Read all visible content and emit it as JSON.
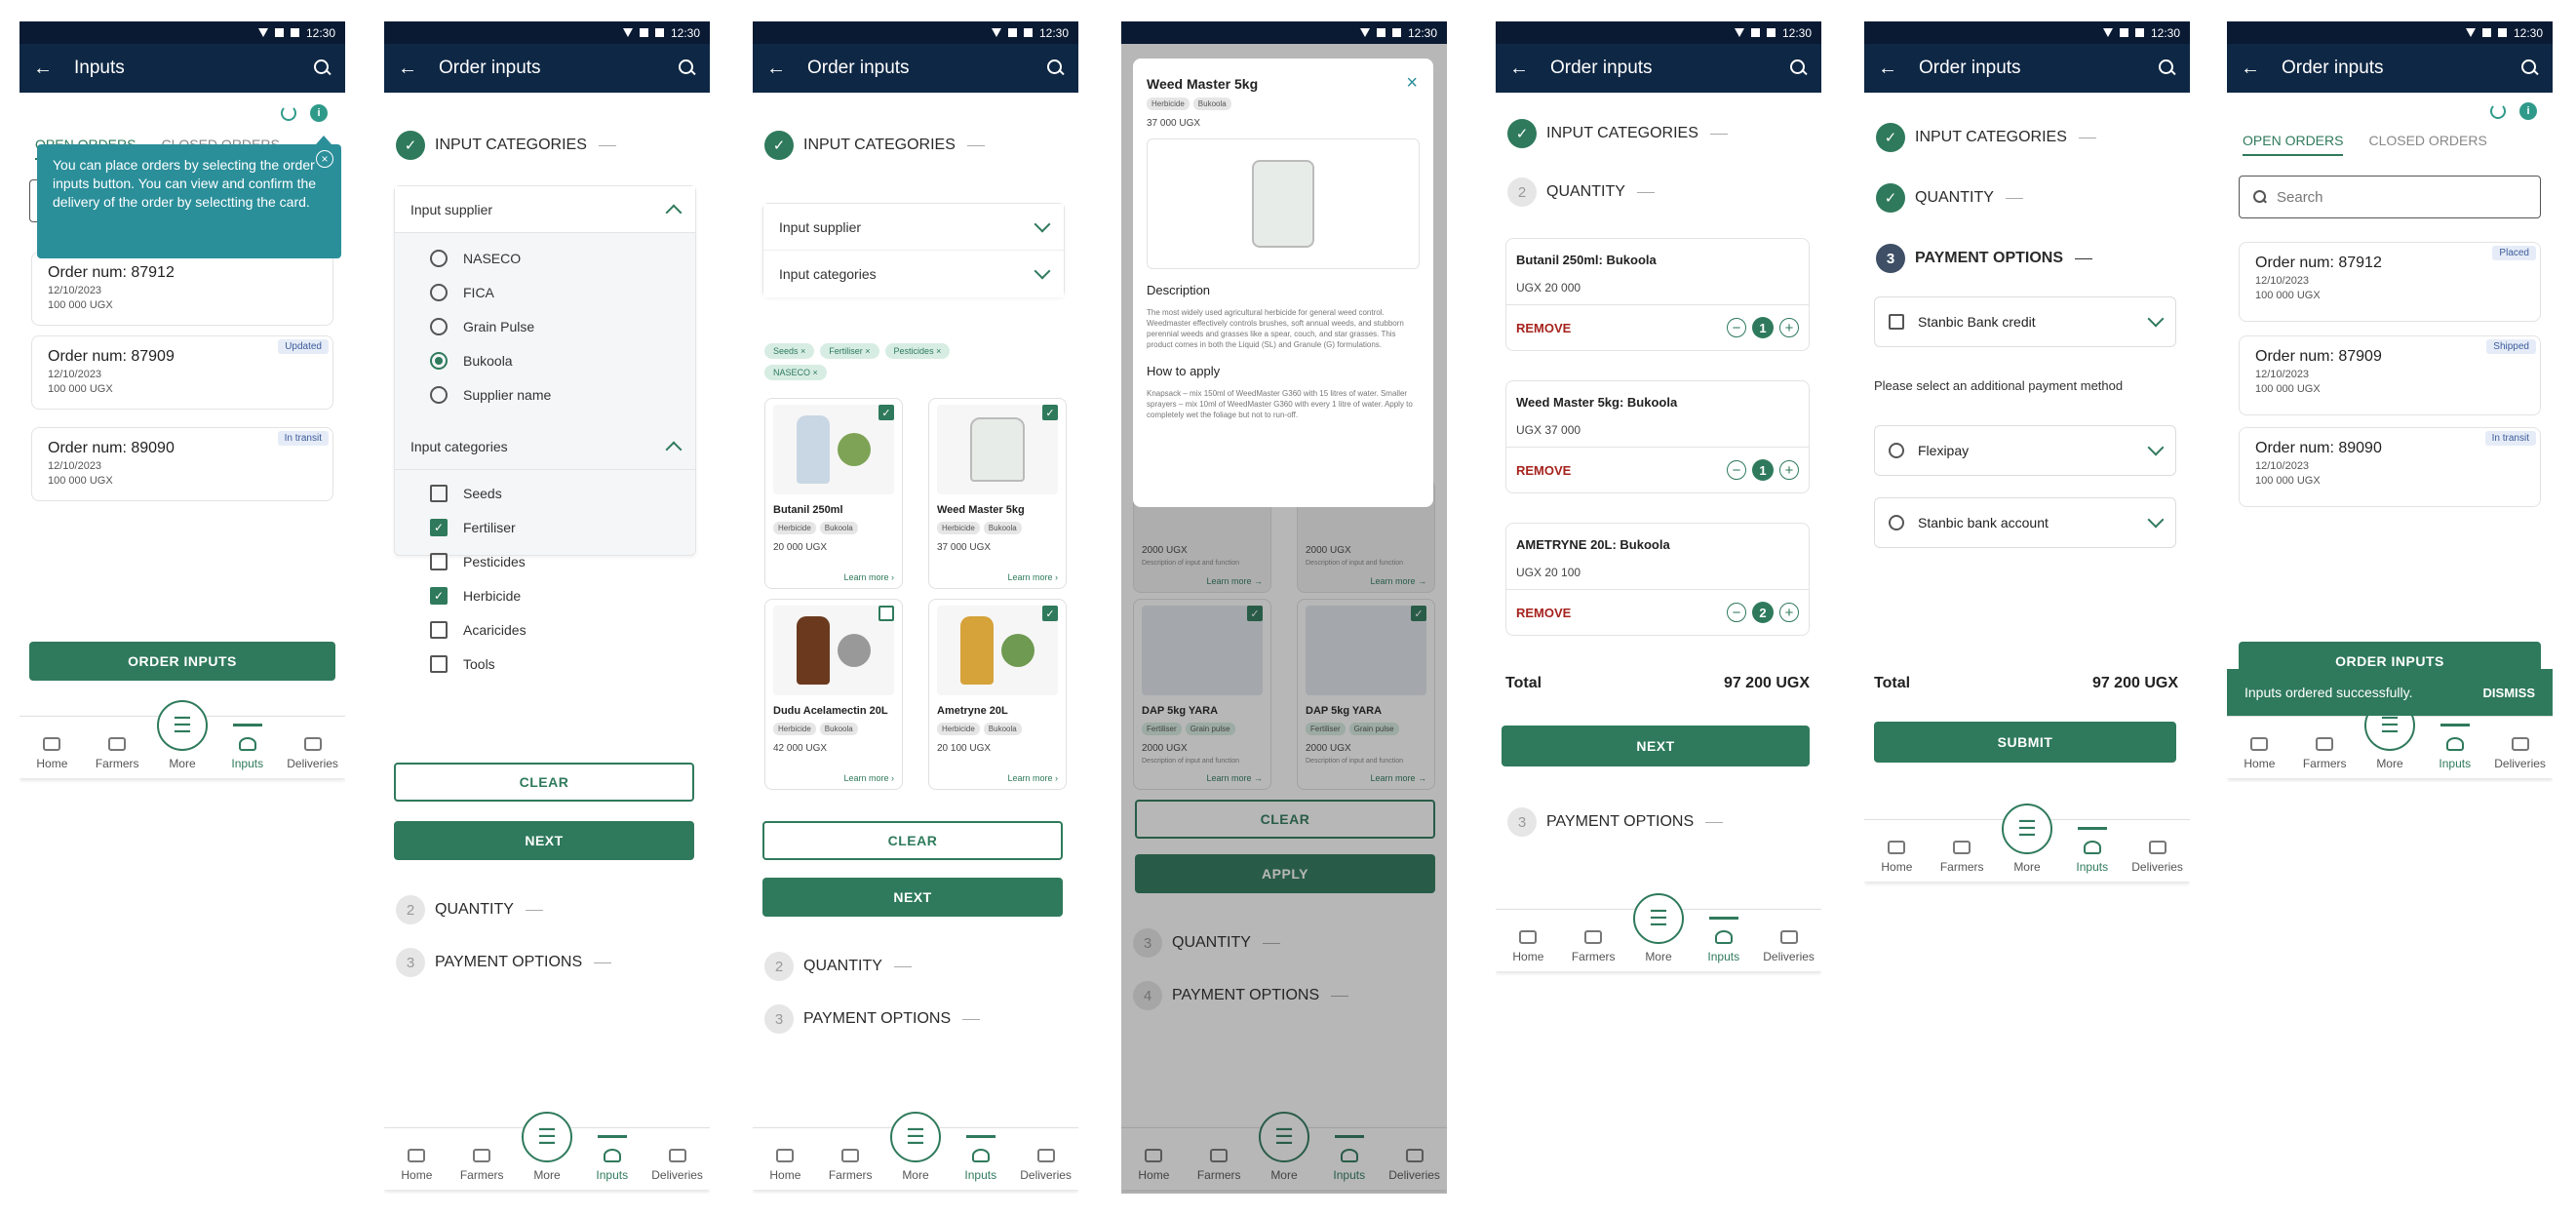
{
  "status": {
    "time": "12:30"
  },
  "common": {
    "nav": [
      "Home",
      "Farmers",
      "More",
      "Inputs",
      "Deliveries"
    ],
    "steps": {
      "categories": "INPUT CATEGORIES",
      "quantity": "QUANTITY",
      "payment": "PAYMENT OPTIONS"
    },
    "step_nums": {
      "two": "2",
      "three": "3",
      "four": "4"
    },
    "buttons": {
      "clear": "CLEAR",
      "next": "NEXT",
      "apply": "APPLY",
      "submit": "SUBMIT",
      "order_inputs": "ORDER INPUTS",
      "remove": "REMOVE",
      "dismiss": "DISMISS"
    }
  },
  "screen1": {
    "title": "Inputs",
    "tabs": [
      "OPEN ORDERS",
      "CLOSED ORDERS"
    ],
    "tooltip": "You can place orders by selecting the order inputs button. You can view and confirm the delivery of the order by selectting the card.",
    "orders": [
      {
        "num": "Order num: 87912",
        "date": "12/10/2023",
        "amount": "100 000 UGX",
        "badge": ""
      },
      {
        "num": "Order num: 87909",
        "date": "12/10/2023",
        "amount": "100 000 UGX",
        "badge": "Updated"
      },
      {
        "num": "Order num: 89090",
        "date": "12/10/2023",
        "amount": "100 000 UGX",
        "badge": "In transit"
      }
    ]
  },
  "screen2": {
    "title": "Order inputs",
    "supplier_label": "Input supplier",
    "suppliers": [
      "NASECO",
      "FICA",
      "Grain Pulse",
      "Bukoola",
      "Supplier name"
    ],
    "categories_label": "Input categories",
    "categories": [
      "Seeds",
      "Fertiliser",
      "Pesticides",
      "Herbicide",
      "Acaricides",
      "Tools"
    ]
  },
  "screen3": {
    "title": "Order inputs",
    "chips": [
      "Seeds ×",
      "Fertiliser ×",
      "Pesticides ×",
      "NASECO ×"
    ],
    "products": [
      {
        "name": "Butanil 250ml",
        "tags": [
          "Herbicide",
          "Bukoola"
        ],
        "price": "20 000 UGX",
        "link": "Learn more ›"
      },
      {
        "name": "Weed Master 5kg",
        "tags": [
          "Herbicide",
          "Bukoola"
        ],
        "price": "37 000 UGX",
        "link": "Learn more ›"
      },
      {
        "name": "Dudu Acelamectin 20L",
        "tags": [
          "Herbicide",
          "Bukoola"
        ],
        "price": "42 000 UGX",
        "link": "Learn more ›"
      },
      {
        "name": "Ametryne 20L",
        "tags": [
          "Herbicide",
          "Bukoola"
        ],
        "price": "20 100 UGX",
        "link": "Learn more ›"
      }
    ]
  },
  "screen4": {
    "modal_title": "Weed Master 5kg",
    "tags": [
      "Herbicide",
      "Bukoola"
    ],
    "price": "37 000 UGX",
    "desc_label": "Description",
    "description": "The most widely used agricultural herbicide for general weed control. Weedmaster effectively controls brushes, soft annual weeds, and stubborn perennial weeds and grasses like a spear, couch, and star grasses. This product comes in both the Liquid (SL) and Granule (G) formulations.",
    "apply_label": "How to apply",
    "apply_text": "Knapsack – mix 150ml of WeedMaster G360 with 15 litres of water. Smaller sprayers – mix 10ml of WeedMaster G360 with every 1 litre of water. Apply to completely wet the foliage but not to run-off.",
    "bg_cards": [
      {
        "price": "2000 UGX",
        "desc": "Description of input and function",
        "link": "Learn more →"
      },
      {
        "price": "2000 UGX",
        "desc": "Description of input and function",
        "link": "Learn more →"
      },
      {
        "name": "DAP 5kg YARA",
        "tags": [
          "Fertiliser",
          "Grain pulse"
        ],
        "price": "2000 UGX",
        "desc": "Description of input and function",
        "link": "Learn more →"
      },
      {
        "name": "DAP 5kg YARA",
        "tags": [
          "Fertiliser",
          "Grain pulse"
        ],
        "price": "2000 UGX",
        "desc": "Description of input and function",
        "link": "Learn more →"
      }
    ]
  },
  "screen5": {
    "title": "Order inputs",
    "items": [
      {
        "name": "Butanil 250ml: Bukoola",
        "price": "UGX 20 000",
        "qty": "1"
      },
      {
        "name": "Weed Master 5kg: Bukoola",
        "price": "UGX 37 000",
        "qty": "1"
      },
      {
        "name": "AMETRYNE 20L: Bukoola",
        "price": "UGX  20 100",
        "qty": "2"
      }
    ],
    "total_label": "Total",
    "total": "97 200 UGX"
  },
  "screen6": {
    "title": "Order inputs",
    "primary": "Stanbic Bank credit",
    "additional_prompt": "Please select an additional payment method",
    "methods": [
      "Flexipay",
      "Stanbic bank account"
    ],
    "total_label": "Total",
    "total": "97 200 UGX"
  },
  "screen7": {
    "title": "Order inputs",
    "tabs": [
      "OPEN ORDERS",
      "CLOSED ORDERS"
    ],
    "search_placeholder": "Search",
    "orders": [
      {
        "num": "Order num: 87912",
        "date": "12/10/2023",
        "amount": "100 000 UGX",
        "badge": "Placed"
      },
      {
        "num": "Order num: 87909",
        "date": "12/10/2023",
        "amount": "100 000 UGX",
        "badge": "Shipped"
      },
      {
        "num": "Order num: 89090",
        "date": "12/10/2023",
        "amount": "100 000 UGX",
        "badge": "In transit"
      }
    ],
    "snackbar": "Inputs ordered successfully."
  },
  "colors": {
    "primary": "#2f7a5c",
    "appbar": "#0e2744",
    "tooltip": "#2b8f9a",
    "remove": "#a6231e"
  }
}
